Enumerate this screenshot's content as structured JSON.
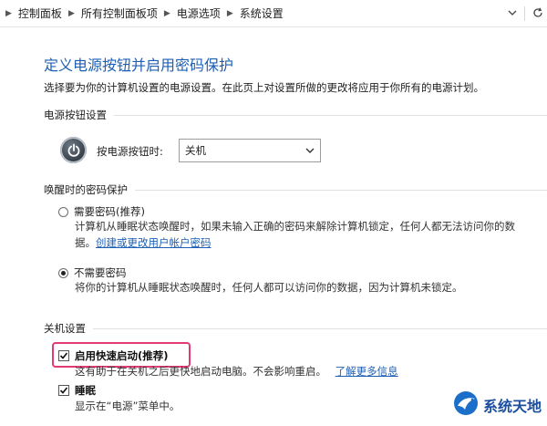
{
  "breadcrumb": [
    "控制面板",
    "所有控制面板项",
    "电源选项",
    "系统设置"
  ],
  "page": {
    "title": "定义电源按钮并启用密码保护",
    "subtitle": "选择要为你的计算机设置的电源设置。在此页上对设置所做的更改将应用于你所有的电源计划。"
  },
  "power_button": {
    "section": "电源按钮设置",
    "label": "按电源按钮时:",
    "selected": "关机"
  },
  "wake_password": {
    "section": "唤醒时的密码保护",
    "require": {
      "label": "需要密码(推荐)",
      "desc": "计算机从睡眠状态唤醒时，如果未输入正确的密码来解除计算机锁定，任何人都无法访问你的数",
      "desc_cont": "据。",
      "link": "创建或更改用户帐户密码",
      "selected": false
    },
    "no_require": {
      "label": "不需要密码",
      "desc": "将你的计算机从睡眠状态唤醒时，任何人都可以访问你的数据，因为计算机未锁定。",
      "selected": true
    }
  },
  "shutdown": {
    "section": "关机设置",
    "fast_startup": {
      "label": "启用快速启动(推荐)",
      "desc": "这有助于在关机之后更快地启动电脑。不会影响重启。",
      "link": "了解更多信息",
      "checked": true
    },
    "sleep": {
      "label": "睡眠",
      "desc": "显示在“电源”菜单中。",
      "checked": true
    }
  },
  "watermark": {
    "text": "系统天地",
    "color": "#1b4e9e"
  },
  "colors": {
    "title": "#1d5fb4",
    "highlight": "#e43a73",
    "link": "#1d5fb4"
  }
}
